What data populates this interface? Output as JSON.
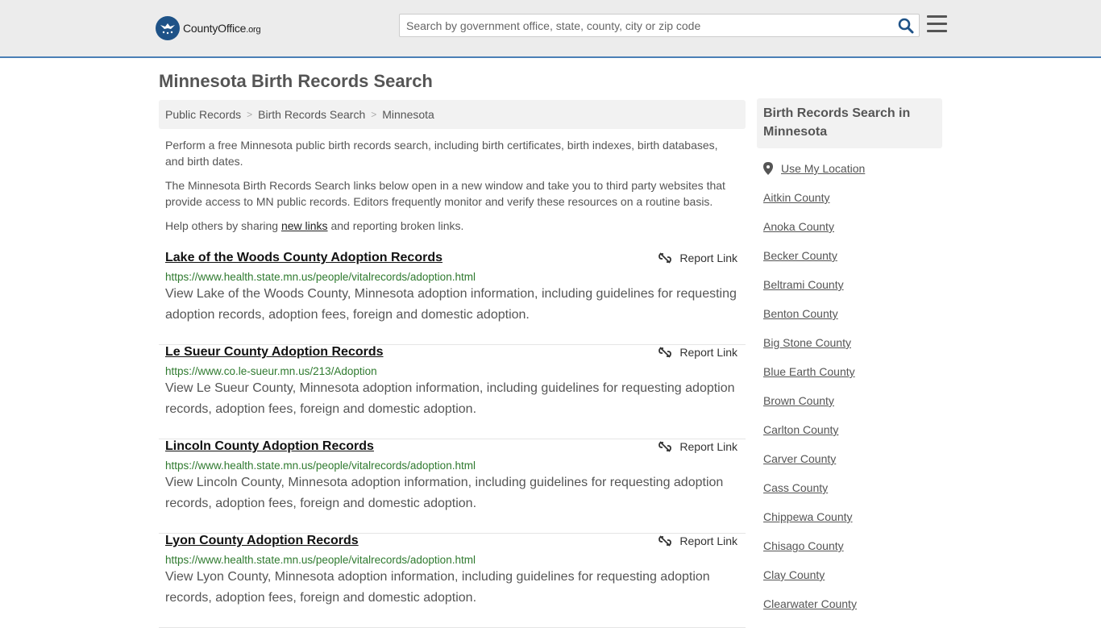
{
  "header": {
    "logo_text": "CountyOffice",
    "logo_suffix": ".org",
    "search_placeholder": "Search by government office, state, county, city or zip code"
  },
  "page": {
    "title": "Minnesota Birth Records Search"
  },
  "breadcrumb": [
    "Public Records",
    "Birth Records Search",
    "Minnesota"
  ],
  "intro": {
    "p1": "Perform a free Minnesota public birth records search, including birth certificates, birth indexes, birth databases, and birth dates.",
    "p2": "The Minnesota Birth Records Search links below open in a new window and take you to third party websites that provide access to MN public records. Editors frequently monitor and verify these resources on a routine basis.",
    "p3_before": "Help others by sharing ",
    "p3_link": "new links",
    "p3_after": " and reporting broken links."
  },
  "report_label": "Report Link",
  "results": [
    {
      "title": "Lake of the Woods County Adoption Records",
      "url": "https://www.health.state.mn.us/people/vitalrecords/adoption.html",
      "desc": "View Lake of the Woods County, Minnesota adoption information, including guidelines for requesting adoption records, adoption fees, foreign and domestic adoption."
    },
    {
      "title": "Le Sueur County Adoption Records",
      "url": "https://www.co.le-sueur.mn.us/213/Adoption",
      "desc": "View Le Sueur County, Minnesota adoption information, including guidelines for requesting adoption records, adoption fees, foreign and domestic adoption."
    },
    {
      "title": "Lincoln County Adoption Records",
      "url": "https://www.health.state.mn.us/people/vitalrecords/adoption.html",
      "desc": "View Lincoln County, Minnesota adoption information, including guidelines for requesting adoption records, adoption fees, foreign and domestic adoption."
    },
    {
      "title": "Lyon County Adoption Records",
      "url": "https://www.health.state.mn.us/people/vitalrecords/adoption.html",
      "desc": "View Lyon County, Minnesota adoption information, including guidelines for requesting adoption records, adoption fees, foreign and domestic adoption."
    }
  ],
  "sidebar": {
    "heading": "Birth Records Search in Minnesota",
    "use_location": "Use My Location",
    "counties": [
      "Aitkin County",
      "Anoka County",
      "Becker County",
      "Beltrami County",
      "Benton County",
      "Big Stone County",
      "Blue Earth County",
      "Brown County",
      "Carlton County",
      "Carver County",
      "Cass County",
      "Chippewa County",
      "Chisago County",
      "Clay County",
      "Clearwater County"
    ]
  },
  "colors": {
    "brand_blue": "#1e5287",
    "header_border": "#4a7fb5",
    "url_green": "#2f7a2f"
  }
}
